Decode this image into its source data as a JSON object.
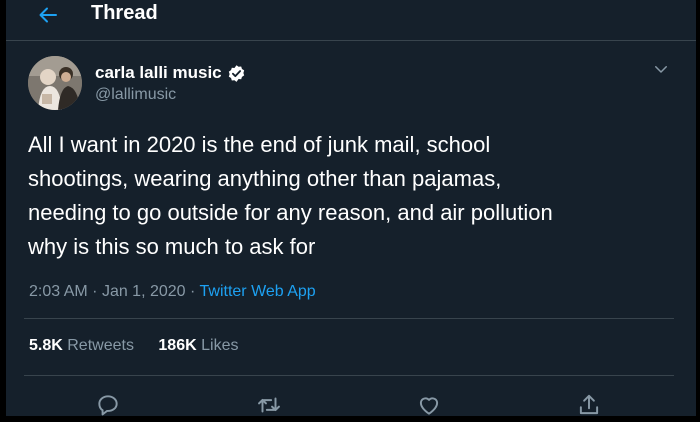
{
  "header": {
    "title": "Thread",
    "back_icon": "arrow-left-icon"
  },
  "tweet": {
    "author": {
      "name": "carla lalli music",
      "handle": "@lallimusic",
      "verified": true
    },
    "text_lines": [
      "All I want in 2020 is the end of junk mail, school",
      "shootings, wearing anything other than pajamas,",
      "needing to go outside for any reason, and air pollution",
      "why is this so much to ask for"
    ],
    "time": "2:03 AM",
    "date": "Jan 1, 2020",
    "separator": "·",
    "source": "Twitter Web App",
    "stats": {
      "retweets_count": "5.8K",
      "retweets_label": "Retweets",
      "likes_count": "186K",
      "likes_label": "Likes"
    },
    "actions": [
      "reply-icon",
      "retweet-icon",
      "like-icon",
      "share-icon"
    ]
  },
  "colors": {
    "background": "#15202b",
    "text": "#ffffff",
    "secondary_text": "#8899a6",
    "accent": "#1da1f2",
    "divider": "#38444d",
    "verified_badge": "#ffffff"
  }
}
